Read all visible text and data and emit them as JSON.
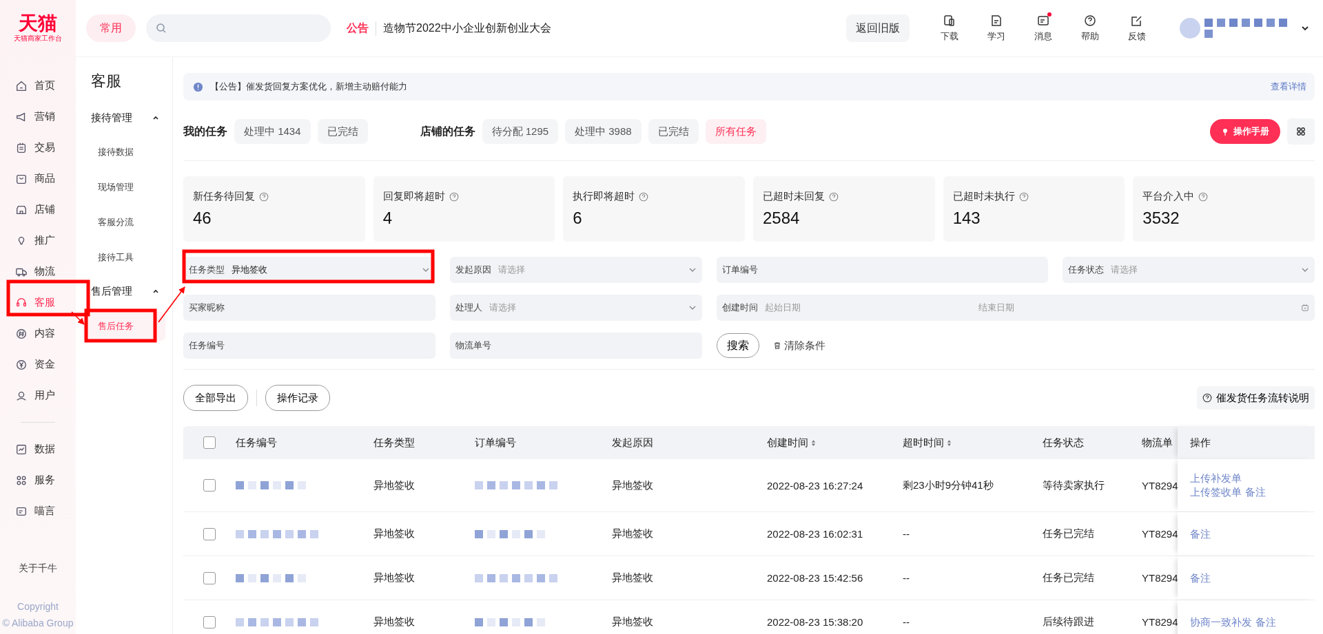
{
  "logo": {
    "name": "天猫",
    "subtitle": "天猫商家工作台"
  },
  "nav": {
    "items": [
      {
        "label": "首页",
        "selected": false
      },
      {
        "label": "营销",
        "selected": false
      },
      {
        "label": "交易",
        "selected": false
      },
      {
        "label": "商品",
        "selected": false
      },
      {
        "label": "店铺",
        "selected": false
      },
      {
        "label": "推广",
        "selected": false
      },
      {
        "label": "物流",
        "selected": false
      },
      {
        "label": "客服",
        "selected": true
      },
      {
        "label": "内容",
        "selected": false
      },
      {
        "label": "资金",
        "selected": false
      },
      {
        "label": "用户",
        "selected": false
      }
    ],
    "extra_items": [
      {
        "label": "数据",
        "selected": false
      },
      {
        "label": "服务",
        "selected": false
      },
      {
        "label": "喵言",
        "selected": false
      }
    ],
    "about": "关于千牛",
    "copyright": "Copyright",
    "company": "© Alibaba Group"
  },
  "topbar": {
    "pill": "常用",
    "notice_tag": "公告",
    "notice": "造物节2022中小企业创新创业大会",
    "old_version": "返回旧版",
    "tools": [
      {
        "label": "下载",
        "badge": false
      },
      {
        "label": "学习",
        "badge": false
      },
      {
        "label": "消息",
        "badge": true
      },
      {
        "label": "帮助",
        "badge": false
      },
      {
        "label": "反馈",
        "badge": false
      }
    ]
  },
  "subnav": {
    "title": "客服",
    "groups": [
      {
        "label": "接待管理",
        "expanded": true,
        "children": [
          {
            "label": "接待数据",
            "selected": false
          },
          {
            "label": "现场管理",
            "selected": false
          },
          {
            "label": "客服分流",
            "selected": false
          },
          {
            "label": "接待工具",
            "selected": false
          }
        ]
      },
      {
        "label": "售后管理",
        "expanded": true,
        "children": [
          {
            "label": "售后任务",
            "selected": true
          }
        ]
      }
    ]
  },
  "announcement": {
    "text": "【公告】催发货回复方案优化，新增主动赔付能力",
    "link": "查看详情"
  },
  "task_tabs": [
    {
      "heading": "我的任务",
      "tabs": [
        {
          "label": "处理中 1434",
          "selected": false
        },
        {
          "label": "已完结",
          "selected": false
        }
      ]
    },
    {
      "heading": "店铺的任务",
      "tabs": [
        {
          "label": "待分配 1295",
          "selected": false
        },
        {
          "label": "处理中 3988",
          "selected": false
        },
        {
          "label": "已完结",
          "selected": false
        },
        {
          "label": "所有任务",
          "selected": true
        }
      ]
    }
  ],
  "manual_button": "操作手册",
  "stats": [
    {
      "label": "新任务待回复",
      "value": "46"
    },
    {
      "label": "回复即将超时",
      "value": "4"
    },
    {
      "label": "执行即将超时",
      "value": "6"
    },
    {
      "label": "已超时未回复",
      "value": "2584"
    },
    {
      "label": "已超时未执行",
      "value": "143"
    },
    {
      "label": "平台介入中",
      "value": "3532"
    }
  ],
  "filters": [
    [
      {
        "kind": "select",
        "label": "任务类型",
        "value": "异地签收"
      },
      {
        "kind": "select",
        "label": "发起原因",
        "placeholder": "请选择"
      },
      {
        "kind": "input",
        "label": "订单编号"
      },
      {
        "kind": "select",
        "label": "任务状态",
        "placeholder": "请选择"
      }
    ],
    [
      {
        "kind": "input",
        "label": "买家昵称"
      },
      {
        "kind": "select",
        "label": "处理人",
        "placeholder": "请选择"
      },
      {
        "kind": "daterange",
        "label": "创建时间",
        "placeholder": "起始日期",
        "placeholder_end": "结束日期"
      }
    ],
    [
      {
        "kind": "input",
        "label": "任务编号"
      },
      {
        "kind": "input",
        "label": "物流单号"
      }
    ]
  ],
  "search_button": "搜索",
  "clear_button": "清除条件",
  "actions": [
    "全部导出",
    "操作记录"
  ],
  "flow_help": "催发货任务流转说明",
  "table": {
    "select_all": {
      "checked": false
    },
    "columns": [
      {
        "label": "任务编号",
        "sortable": false
      },
      {
        "label": "任务类型",
        "sortable": false
      },
      {
        "label": "订单编号",
        "sortable": false
      },
      {
        "label": "发起原因",
        "sortable": false
      },
      {
        "label": "创建时间",
        "sortable": true
      },
      {
        "label": "超时时间",
        "sortable": true
      },
      {
        "label": "任务状态",
        "sortable": false
      },
      {
        "label": "物流单",
        "sortable": false
      },
      {
        "label": "操作",
        "sortable": false
      }
    ],
    "rows": [
      {
        "checked": false,
        "type": "异地签收",
        "reason": "异地签收",
        "created": "2022-08-23 16:27:24",
        "timeout": "剩23小时9分钟41秒",
        "status": "等待卖家执行",
        "logistics": "YT8294",
        "ops": [
          "上传补发单",
          "上传签收单",
          "备注"
        ]
      },
      {
        "checked": false,
        "type": "异地签收",
        "reason": "异地签收",
        "created": "2022-08-23 16:02:31",
        "timeout": "--",
        "status": "任务已完结",
        "logistics": "YT8294",
        "ops": [
          "备注"
        ]
      },
      {
        "checked": false,
        "type": "异地签收",
        "reason": "异地签收",
        "created": "2022-08-23 15:42:56",
        "timeout": "--",
        "status": "任务已完结",
        "logistics": "YT8294",
        "ops": [
          "备注"
        ]
      },
      {
        "checked": false,
        "type": "异地签收",
        "reason": "异地签收",
        "created": "2022-08-23 15:38:20",
        "timeout": "--",
        "status": "后续待跟进",
        "logistics": "YT8294",
        "ops": [
          "协商一致补发",
          "备注"
        ]
      }
    ]
  }
}
